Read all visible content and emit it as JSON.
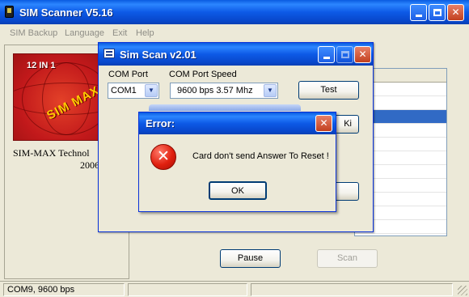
{
  "main": {
    "title": "SIM Scanner V5.16",
    "menu": [
      "SIM Backup",
      "Language",
      "Exit",
      "Help"
    ],
    "logo_text_top": "12 IN 1",
    "logo_text_brand": "SIM MAX",
    "company": "SIM-MAX Technol",
    "year": "2006",
    "pause_label": "Pause",
    "scan_label": "Scan",
    "status": "COM9, 9600 bps"
  },
  "scan_dialog": {
    "title": "Sim Scan v2.01",
    "com_port_label": "COM Port",
    "com_port_value": "COM1",
    "speed_label": "COM Port Speed",
    "speed_value": "9600 bps  3.57 Mhz",
    "test_label": "Test",
    "partial_button_text": "Ki"
  },
  "error_dialog": {
    "title": "Error:",
    "message": "Card don't send Answer To Reset !",
    "ok_label": "OK",
    "close_glyph": "✕"
  },
  "icons": {
    "app_icon": "sim-card-icon",
    "error_icon": "error-x-icon"
  },
  "colors": {
    "title_bar": "#0a5be0",
    "window_face": "#ece9d8",
    "selection": "#316ac5",
    "error_icon": "#e0200f"
  }
}
